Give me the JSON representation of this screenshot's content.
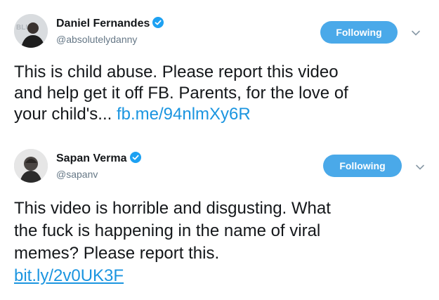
{
  "tweets": [
    {
      "author": {
        "name": "Daniel Fernandes",
        "handle": "@absolutelydanny",
        "verified_icon": "verified-badge-icon"
      },
      "follow_label": "Following",
      "text_lines": [
        "This is child abuse. Please report this video",
        "and help get it off FB. Parents, for the love of",
        "your child's... "
      ],
      "link": "fb.me/94nlmXy6R"
    },
    {
      "author": {
        "name": "Sapan Verma",
        "handle": "@sapanv",
        "verified_icon": "verified-badge-icon"
      },
      "follow_label": "Following",
      "text_lines": [
        "This video is horrible and disgusting. What",
        "the fuck is happening in the name of viral",
        "memes? Please report this."
      ],
      "link": "bit.ly/2v0UK3F"
    }
  ],
  "colors": {
    "follow_button": "#4aa9e9",
    "link": "#1b95e0",
    "verified": "#1da1f2",
    "handle": "#657786"
  }
}
